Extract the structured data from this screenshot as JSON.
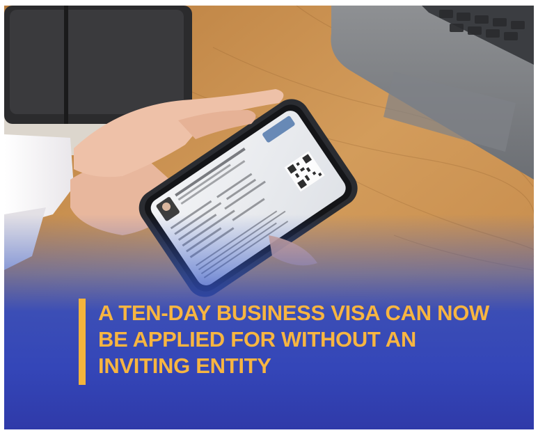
{
  "headline": "A TEN-DAY BUSINESS VISA CAN NOW BE APPLIED FOR WITHOUT AN INVITING ENTITY",
  "colors": {
    "headline_text": "#f7b541",
    "accent_bar": "#f4b43c",
    "gradient_blue": "#3446b8",
    "desk_wood": "#c9924f"
  },
  "icons": {
    "qr_code": "qr-code-icon"
  }
}
